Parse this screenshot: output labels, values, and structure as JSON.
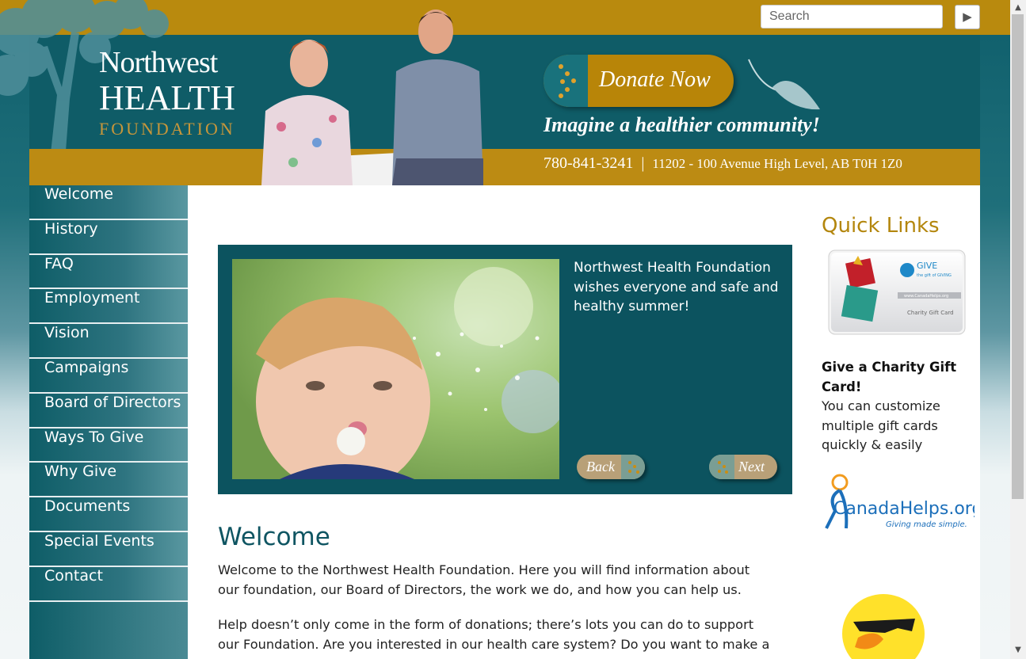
{
  "search": {
    "placeholder": "Search",
    "button": "▶"
  },
  "logo": {
    "line1": "Northwest",
    "line2": "HEALTH",
    "line3": "FOUNDATION"
  },
  "header": {
    "donate": "Donate Now",
    "tagline": "Imagine a healthier community!",
    "phone": "780-841-3241",
    "separator": "|",
    "address": "11202 - 100 Avenue High Level, AB T0H 1Z0"
  },
  "nav": {
    "items": [
      {
        "label": "Welcome"
      },
      {
        "label": "History"
      },
      {
        "label": "FAQ"
      },
      {
        "label": "Employment"
      },
      {
        "label": "Vision"
      },
      {
        "label": "Campaigns"
      },
      {
        "label": "Board of Directors"
      },
      {
        "label": "Ways To Give"
      },
      {
        "label": "Why Give"
      },
      {
        "label": "Documents"
      },
      {
        "label": "Special Events"
      },
      {
        "label": "Contact"
      }
    ]
  },
  "slider": {
    "caption": "Northwest Health Foundation wishes everyone and safe and healthy summer!",
    "back": "Back",
    "next": "Next"
  },
  "main": {
    "heading": "Welcome",
    "p1": "Welcome to the Northwest Health Foundation. Here you will find information about our foundation, our Board of Directors, the work we do, and how you can help us.",
    "p2": "Help doesn’t only come in the form of donations;  there’s lots you can do to support our Foundation. Are you interested in our health care system?  Do you want to make a"
  },
  "quicklinks": {
    "title": "Quick Links",
    "gift_card_heading": "Give a Charity Gift Card!",
    "gift_card_body": "You can customize multiple gift cards quickly & easily",
    "gift_card_brand": "GIVE",
    "gift_card_brand_sub": "the gift of GIVING",
    "gift_card_url": "www.CanadaHelps.org",
    "gift_card_label": "Charity Gift Card",
    "canadahelps_name": "CanadaHelps.org",
    "canadahelps_tagline": "Giving made simple."
  },
  "colors": {
    "teal": "#0f5c67",
    "gold": "#b98a0e"
  }
}
